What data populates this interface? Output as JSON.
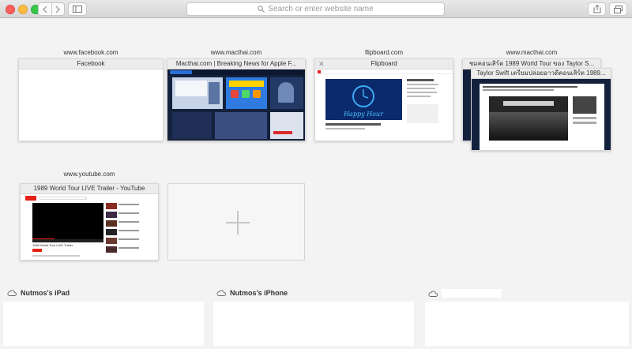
{
  "toolbar": {
    "back_icon": "chevron-left-icon",
    "forward_icon": "chevron-right-icon",
    "sidebar_icon": "sidebar-icon",
    "search_placeholder": "Search or enter website name",
    "share_icon": "share-icon",
    "tabs_icon": "tabs-icon"
  },
  "top_sites": [
    {
      "host": "www.facebook.com",
      "title": "Facebook"
    },
    {
      "host": "www.macthai.com",
      "title": "Macthai.com | Breaking News for Apple F..."
    },
    {
      "host": "flipboard.com",
      "title": "Flipboard"
    },
    {
      "host": "www.macthai.com",
      "title": "ชมคอนเสิร์ต 1989 World Tour ของ Taylor S...",
      "back_title": "Taylor Swift เตรียมปล่อยอาวดีคอนเสิร์ต 1989..."
    },
    {
      "host": "www.youtube.com",
      "title": "1989 World Tour LIVE Trailer - YouTube"
    }
  ],
  "flipboard_mock": {
    "brand": "Flipboard",
    "heading": "Happy Hour"
  },
  "youtube_mock": {
    "caption": "1989 World Tour LIVE Trailer"
  },
  "devices": [
    {
      "name": "Nutmos's iPad",
      "icon": "cloud-icon"
    },
    {
      "name": "Nutmos's iPhone",
      "icon": "cloud-icon"
    },
    {
      "name": "",
      "icon": "cloud-icon"
    }
  ],
  "colors": {
    "close_red": "#fc605c",
    "minimize_yellow": "#fdbc40",
    "zoom_green": "#34c84a",
    "macthai_blue": "#14213d",
    "youtube_red": "#e62117"
  }
}
